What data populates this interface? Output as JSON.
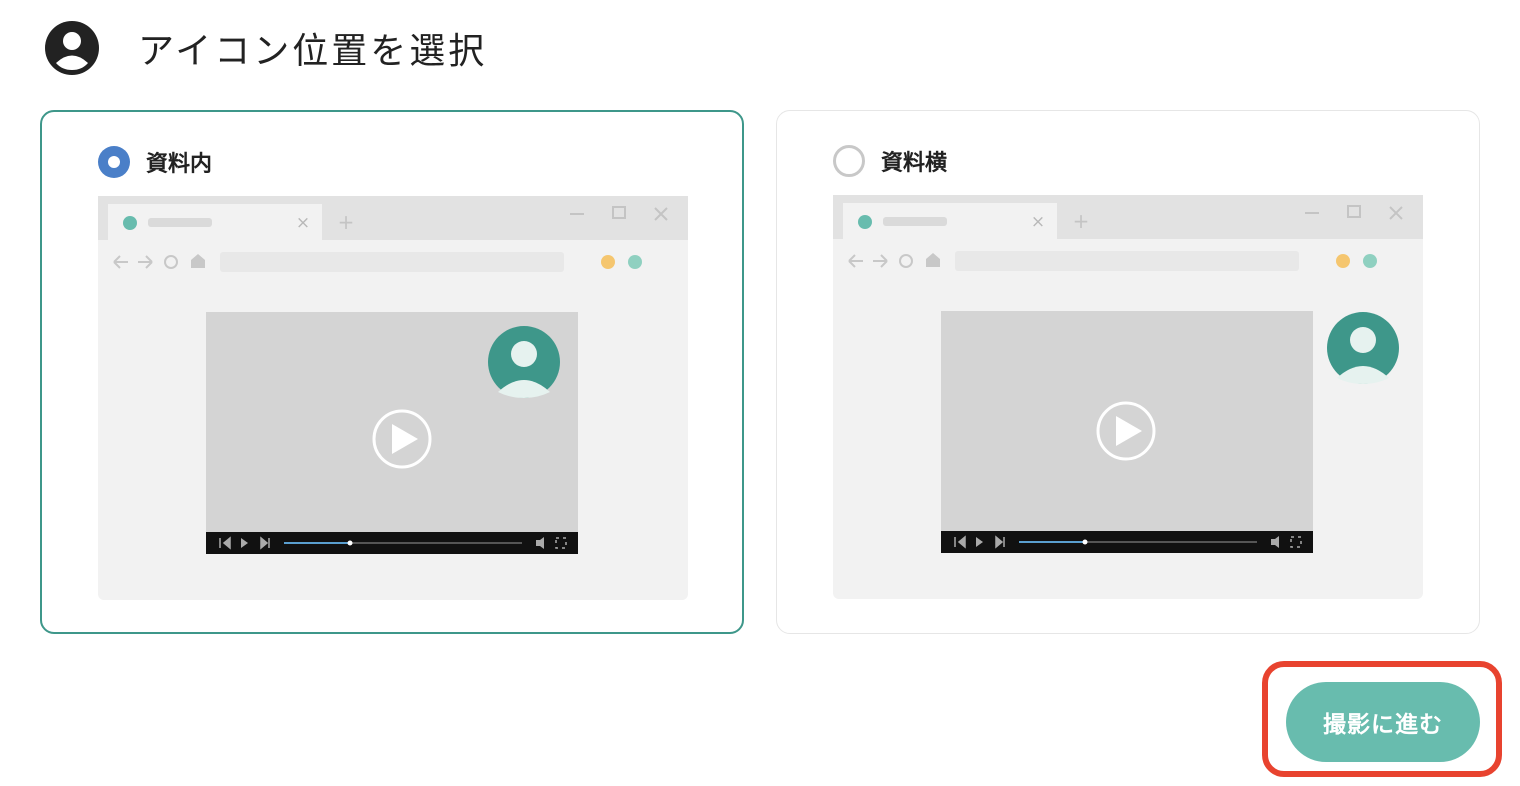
{
  "header": {
    "title": "アイコン位置を選択",
    "icon": "user-circle-icon"
  },
  "options": [
    {
      "label": "資料内",
      "selected": true
    },
    {
      "label": "資料横",
      "selected": false
    }
  ],
  "next_button": {
    "label": "撮影に進む"
  },
  "colors": {
    "accent": "#3e978a",
    "button": "#68bcae",
    "radio_checked": "#4a7fc8",
    "highlight": "#e8432f",
    "avatar": "#3e978a"
  }
}
